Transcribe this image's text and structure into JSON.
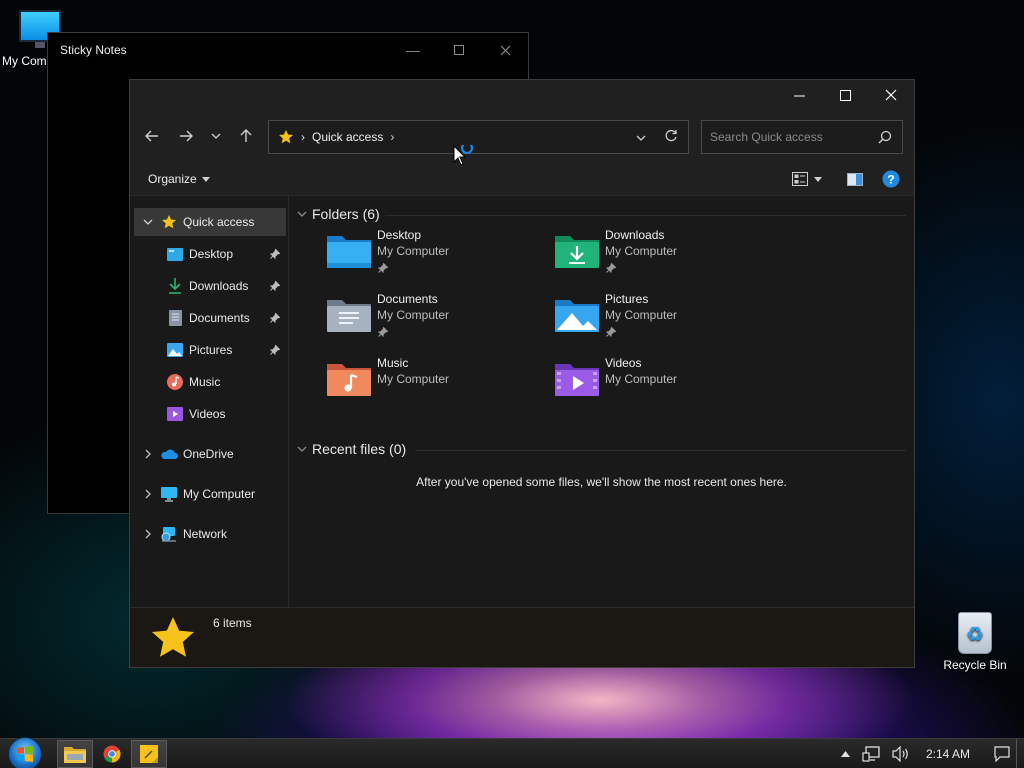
{
  "desktop": {
    "icons": [
      {
        "label": "My Com"
      },
      {
        "label": "Recycle Bin"
      }
    ]
  },
  "sticky_notes": {
    "title": "Sticky Notes"
  },
  "explorer": {
    "address": {
      "crumb": "Quick access"
    },
    "search": {
      "placeholder": "Search Quick access"
    },
    "command_bar": {
      "organize_label": "Organize"
    },
    "nav_pane": {
      "items": [
        {
          "label": "Quick access",
          "icon": "star-icon",
          "selected": true
        },
        {
          "label": "Desktop",
          "icon": "desktop-folder-icon",
          "pinned": true
        },
        {
          "label": "Downloads",
          "icon": "download-icon",
          "pinned": true
        },
        {
          "label": "Documents",
          "icon": "documents-icon",
          "pinned": true
        },
        {
          "label": "Pictures",
          "icon": "pictures-icon",
          "pinned": true
        },
        {
          "label": "Music",
          "icon": "music-icon"
        },
        {
          "label": "Videos",
          "icon": "videos-icon"
        },
        {
          "label": "OneDrive",
          "icon": "cloud-icon"
        },
        {
          "label": "My Computer",
          "icon": "computer-icon"
        },
        {
          "label": "Network",
          "icon": "network-icon"
        }
      ]
    },
    "folders_group": {
      "header": "Folders (6)",
      "folders": [
        {
          "name": "Desktop",
          "location": "My Computer",
          "pinned": true
        },
        {
          "name": "Downloads",
          "location": "My Computer",
          "pinned": true
        },
        {
          "name": "Documents",
          "location": "My Computer",
          "pinned": true
        },
        {
          "name": "Pictures",
          "location": "My Computer",
          "pinned": true
        },
        {
          "name": "Music",
          "location": "My Computer",
          "pinned": false
        },
        {
          "name": "Videos",
          "location": "My Computer",
          "pinned": false
        }
      ]
    },
    "recent_group": {
      "header": "Recent files (0)",
      "empty_message": "After you've opened some files, we'll show the most recent ones here."
    },
    "status": {
      "item_count": "6 items"
    }
  },
  "taskbar": {
    "clock": "2:14 AM"
  },
  "colors": {
    "accent_blue": "#2b8fe0",
    "star_yellow": "#f7c21c",
    "selected_bg": "#383838"
  }
}
